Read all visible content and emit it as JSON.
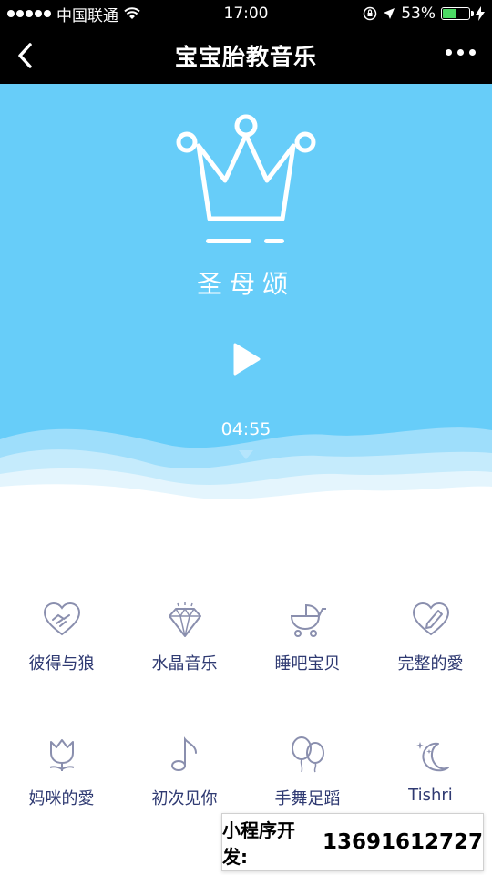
{
  "status_bar": {
    "carrier": "中国联通",
    "time": "17:00",
    "battery": "53%",
    "battery_level": 0.53,
    "battery_color": "#4cd964"
  },
  "nav": {
    "title": "宝宝胎教音乐",
    "back_icon": "chevron-left-icon",
    "more_icon": "more-dots-icon"
  },
  "player": {
    "title": "圣母颂",
    "duration": "04:55",
    "play_icon": "play-icon",
    "background_color": "#67cdf9"
  },
  "categories": [
    {
      "label": "彼得与狼",
      "icon": "handshake-heart-icon"
    },
    {
      "label": "水晶音乐",
      "icon": "diamond-icon"
    },
    {
      "label": "睡吧宝贝",
      "icon": "stroller-icon"
    },
    {
      "label": "完整的愛",
      "icon": "heart-pencil-icon"
    },
    {
      "label": "妈咪的愛",
      "icon": "tulip-icon"
    },
    {
      "label": "初次见你",
      "icon": "music-note-icon"
    },
    {
      "label": "手舞足蹈",
      "icon": "balloons-icon"
    },
    {
      "label": "Tishri",
      "icon": "moon-stars-icon"
    }
  ],
  "badge": {
    "prefix": "小程序开发:",
    "number": "13691612727"
  },
  "colors": {
    "label": "#2f3a72",
    "icon": "#8a8fae"
  }
}
